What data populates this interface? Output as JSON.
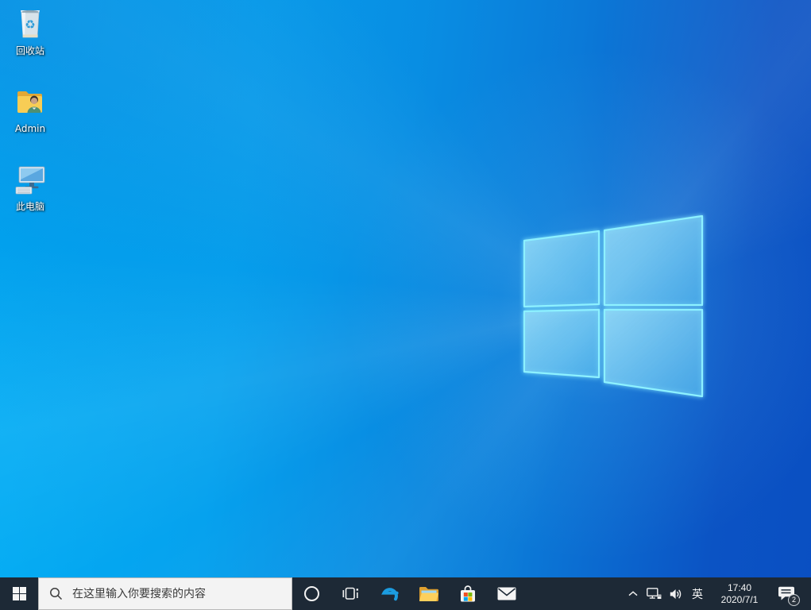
{
  "desktop": {
    "icons": [
      {
        "id": "recycle-bin",
        "label": "回收站"
      },
      {
        "id": "admin-folder",
        "label": "Admin"
      },
      {
        "id": "this-pc",
        "label": "此电脑"
      }
    ]
  },
  "taskbar": {
    "search": {
      "placeholder": "在这里输入你要搜索的内容"
    },
    "apps": [
      {
        "icon": "start-windows-logo"
      },
      {
        "icon": "cortana-ring"
      },
      {
        "icon": "task-view"
      },
      {
        "icon": "edge-browser"
      },
      {
        "icon": "file-explorer"
      },
      {
        "icon": "microsoft-store"
      },
      {
        "icon": "mail"
      }
    ],
    "tray": {
      "hidden_icons_icon": "chevron-up",
      "network_icon": "ethernet-monitor",
      "volume_icon": "speaker-waves",
      "ime_label": "英",
      "time": "17:40",
      "date": "2020/7/1",
      "notification_count": "2"
    }
  },
  "colors": {
    "wallpaper_bright": "#00aef5",
    "wallpaper_dark": "#0a4fc2",
    "logo_edge_glow": "#8df1ff",
    "taskbar_bg": "#1d2936",
    "search_bg": "#f3f3f3",
    "edge_blue": "#1b9ce0",
    "folder_yellow": "#fdd05c",
    "store_red": "#f25022",
    "store_green": "#7fba00",
    "store_blue": "#00a4ef",
    "store_yellow": "#ffb900"
  }
}
